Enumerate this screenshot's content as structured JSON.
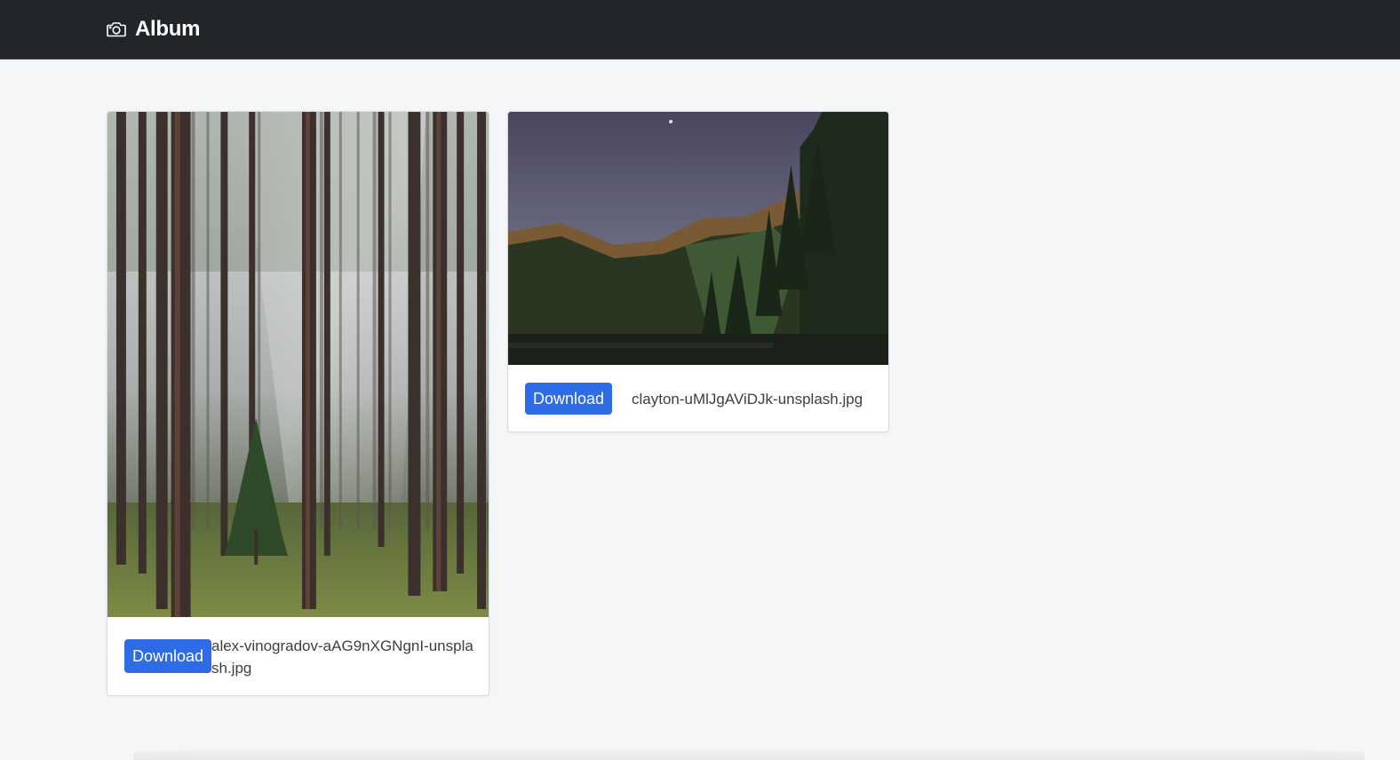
{
  "navbar": {
    "brand_icon": "camera-icon",
    "brand_title": "Album",
    "background": "#212529"
  },
  "page": {
    "background": "#f5f6f8"
  },
  "photos": [
    {
      "image": "forest-pine-trees-photo",
      "download_label": "Download",
      "filename": "alex-vinogradov-aAG9nXGNgnI-unsplash.jpg"
    },
    {
      "image": "mountain-lake-night-photo",
      "download_label": "Download",
      "filename": "clayton-uMlJgAViDJk-unsplash.jpg"
    }
  ],
  "colors": {
    "button": "#2d6ce6"
  }
}
